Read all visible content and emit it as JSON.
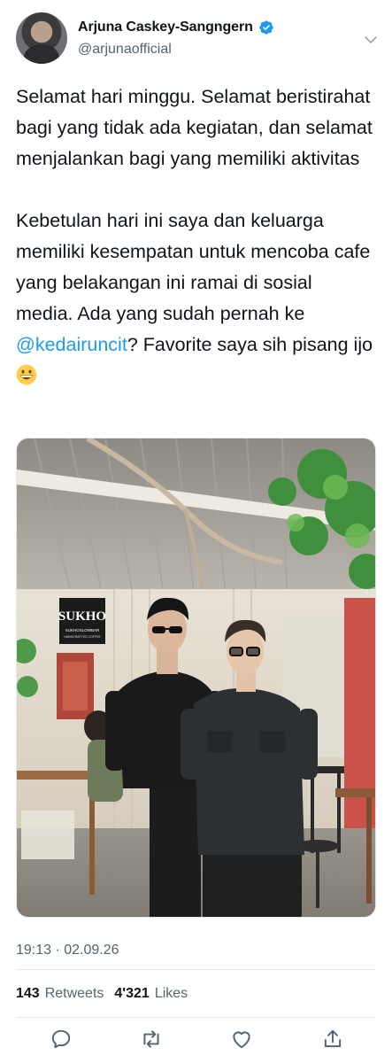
{
  "author": {
    "display_name": "Arjuna Caskey-Sangngern",
    "handle": "@arjunaofficial",
    "verified": true,
    "avatar_icon": "profile-photo"
  },
  "tweet": {
    "paragraph1": "Selamat hari minggu. Selamat beristirahat bagi yang tidak ada kegiatan, dan selamat menjalankan bagi yang memiliki aktivitas",
    "paragraph2_part1": "Kebetulan hari ini saya dan keluarga memiliki kesempatan untuk mencoba cafe yang belakangan ini ramai di sosial media. Ada yang sudah pernah ke ",
    "mention": "@kedairuncit",
    "paragraph2_part2": "? Favorite saya sih pisang ijo ",
    "emoji": "grinning-face-emoji"
  },
  "photo": {
    "sign_line1": "SUKHO",
    "sign_line2": "SUKHOSLOWBAR",
    "sign_line3": "HANDCRAFTED COFFEE"
  },
  "meta": {
    "timestamp": "19:13 · 02.09.26"
  },
  "stats": {
    "retweets_count": "143",
    "retweets_label": "Retweets",
    "likes_count": "4'321",
    "likes_label": "Likes"
  },
  "actions": [
    "reply-icon",
    "retweet-icon",
    "like-icon",
    "share-icon"
  ],
  "colors": {
    "accent": "#1d9bf0",
    "text": "#0f1419",
    "secondary": "#536471",
    "border": "#e6e9ea"
  }
}
